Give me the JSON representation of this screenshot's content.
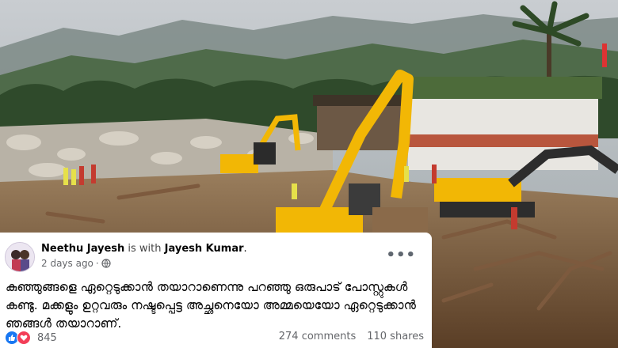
{
  "post": {
    "author": "Neethu Jayesh",
    "with_text": "is with",
    "tagged": "Jayesh Kumar",
    "tagged_suffix": ".",
    "time": "2 days ago",
    "time_sep": "·",
    "text": "കുഞ്ഞുങ്ങളെ ഏറ്റെടുക്കാൻ തയാറാണെന്നു പറഞ്ഞു ഒരുപാട് പോസ്റ്റുകൾ കണ്ടു. മക്കളും ഉറ്റവരും നഷ്ടപ്പെട്ട അച്ഛനെയോ അമ്മയെയോ ഏറ്റെടുക്കാൻ ഞങ്ങൾ തയാറാണ്.",
    "more_icon": "•••",
    "reaction_count": "845",
    "comments": "274 comments",
    "shares": "110 shares"
  },
  "colors": {
    "like": "#1877f2",
    "love": "#f33e58",
    "excavator": "#f2b705"
  },
  "icons": [
    "globe-icon",
    "like-reaction-icon",
    "love-reaction-icon",
    "more-options-icon"
  ]
}
